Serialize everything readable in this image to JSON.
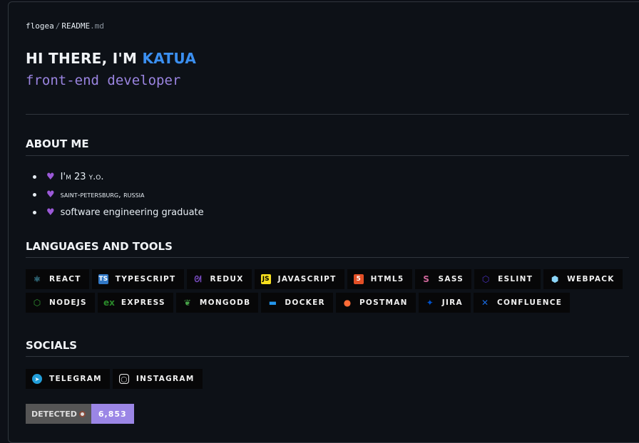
{
  "breadcrumb": {
    "user": "flogea",
    "sep": "/",
    "file": "README",
    "ext": ".md"
  },
  "header": {
    "greeting": "HI THERE, I'M ",
    "name": "KATUA",
    "subtitle": "front-end developer"
  },
  "about": {
    "title": "ABOUT ME",
    "items": [
      "I'm 23 y.o.",
      "saint-petersburg, russia",
      "software engineering graduate"
    ],
    "bullet_icon": "purple-heart"
  },
  "tools": {
    "title": "LANGUAGES AND TOOLS",
    "row1": [
      {
        "label": "REACT",
        "icon": "react",
        "color": "#61dafb"
      },
      {
        "label": "TYPESCRIPT",
        "icon": "typescript",
        "color": "#3178c6"
      },
      {
        "label": "REDUX",
        "icon": "redux",
        "color": "#764abc"
      },
      {
        "label": "JAVASCRIPT",
        "icon": "javascript",
        "color": "#f7df1e"
      },
      {
        "label": "HTML5",
        "icon": "html5",
        "color": "#e34f26"
      },
      {
        "label": "SASS",
        "icon": "sass",
        "color": "#cc6699"
      },
      {
        "label": "ESLINT",
        "icon": "eslint",
        "color": "#4b32c3"
      },
      {
        "label": "WEBPACK",
        "icon": "webpack",
        "color": "#8dd6f9"
      }
    ],
    "row2": [
      {
        "label": "NODEJS",
        "icon": "nodejs",
        "color": "#339933"
      },
      {
        "label": "EXPRESS",
        "icon": "express",
        "color": "#2a8a2a"
      },
      {
        "label": "MONGODB",
        "icon": "mongodb",
        "color": "#47a248"
      },
      {
        "label": "DOCKER",
        "icon": "docker",
        "color": "#2496ed"
      },
      {
        "label": "POSTMAN",
        "icon": "postman",
        "color": "#ff6c37"
      },
      {
        "label": "JIRA",
        "icon": "jira",
        "color": "#0052cc"
      },
      {
        "label": "CONFLUENCE",
        "icon": "confluence",
        "color": "#1868db"
      }
    ]
  },
  "socials": {
    "title": "SOCIALS",
    "items": [
      {
        "label": "TELEGRAM",
        "icon": "telegram"
      },
      {
        "label": "INSTAGRAM",
        "icon": "instagram"
      }
    ]
  },
  "counter": {
    "label": "DETECTED",
    "value": "6,853"
  }
}
